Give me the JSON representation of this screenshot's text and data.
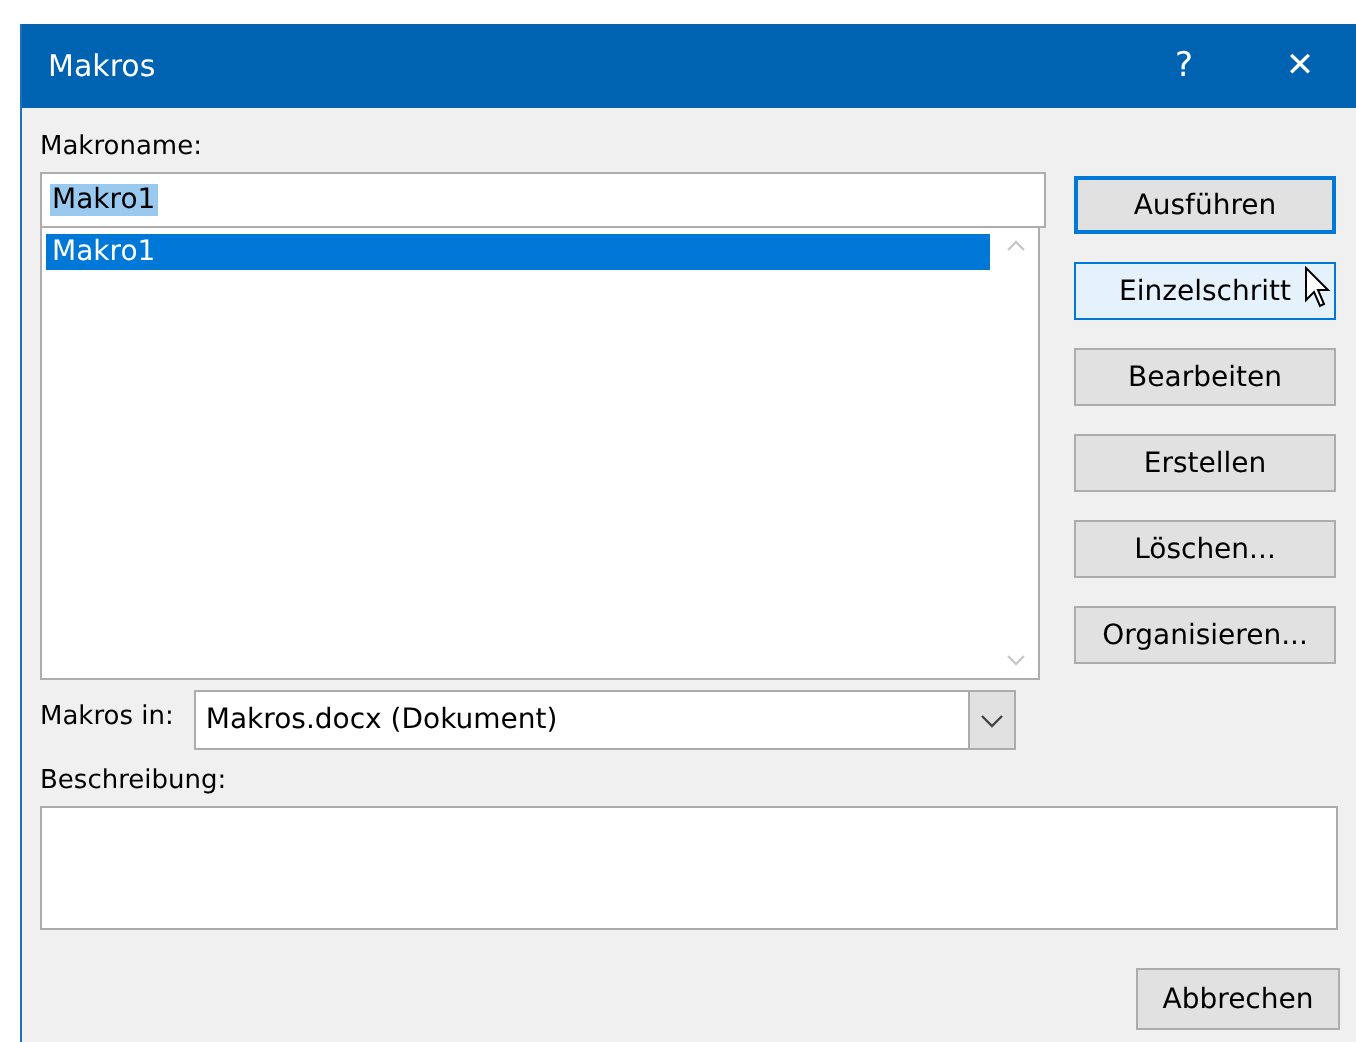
{
  "window": {
    "title": "Makros",
    "help": "?",
    "close": "✕"
  },
  "macro_name": {
    "label": "Makroname:",
    "value": "Makro1",
    "value_selected": true
  },
  "macro_list": {
    "items": [
      {
        "label": "Makro1",
        "selected": true
      }
    ]
  },
  "macros_in": {
    "label": "Makros in:",
    "value": "Makros.docx (Dokument)"
  },
  "description": {
    "label": "Beschreibung:"
  },
  "buttons": [
    {
      "label": "Ausführen",
      "default": true,
      "hovered": false
    },
    {
      "label": "Einzelschritt",
      "default": false,
      "hovered": true
    },
    {
      "label": "Bearbeiten",
      "default": false,
      "hovered": false
    },
    {
      "label": "Erstellen",
      "default": false,
      "hovered": false
    },
    {
      "label": "Löschen...",
      "default": false,
      "hovered": false
    },
    {
      "label": "Organisieren...",
      "default": false,
      "hovered": false
    }
  ],
  "cancel_button": {
    "label": "Abbrechen"
  }
}
